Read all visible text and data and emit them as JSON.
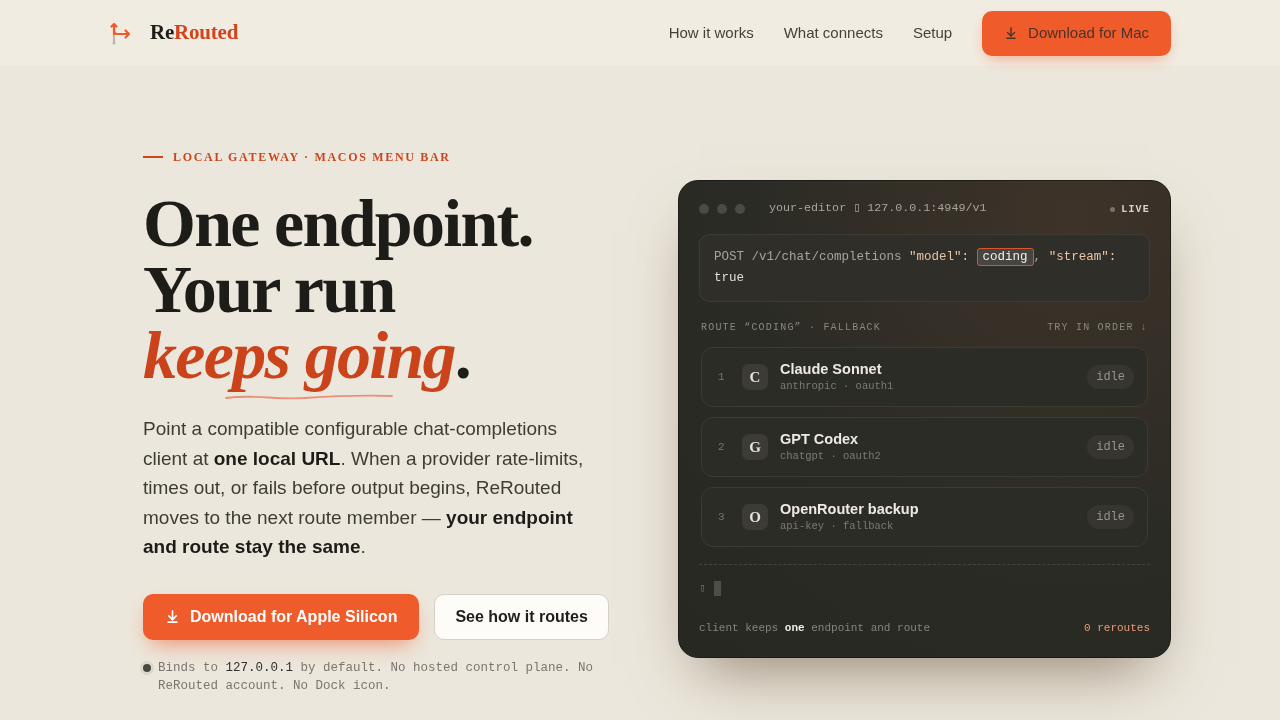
{
  "header": {
    "brand": [
      {
        "text": "Re",
        "kind": "plain"
      },
      {
        "text": "Routed",
        "kind": "accent"
      }
    ],
    "nav": [
      "How it works",
      "What connects",
      "Setup"
    ],
    "cta": "Download for Mac"
  },
  "hero": {
    "eyebrow": "LOCAL GATEWAY · MACOS MENU BAR",
    "headline": "One endpoint.\nYour run\n*keeps going*.",
    "body": "Point a compatible configurable chat-completions client at **one local URL**. When a provider rate-limits, times out, or fails before output begins, ReRouted moves to the next route member — **your endpoint and route stay the same**.",
    "buttons": [
      {
        "label": "Download for Apple Silicon",
        "kind": "primary"
      },
      {
        "label": "See how it routes",
        "kind": "secondary"
      }
    ],
    "note": "Binds to **127.0.0.1** by default. No hosted control plane. No ReRouted account. No Dock icon."
  },
  "terminal": {
    "title": "your-editor ▯ 127.0.0.1:4949/v1",
    "status": "LIVE",
    "request": [
      {
        "text": "POST /v1/chat/completions",
        "kind": "plain"
      },
      {
        "text": "\"model\":",
        "kind": "key"
      },
      {
        "text": "coding",
        "kind": "chip"
      },
      {
        "text": ",",
        "kind": "punct"
      },
      {
        "text": "\"stream\":",
        "kind": "key"
      },
      {
        "text": "true",
        "kind": "value"
      }
    ],
    "route_label": "ROUTE “CODING” · FALLBACK",
    "order_label": "TRY IN ORDER ↓",
    "routes": [
      {
        "index": "1",
        "initial": "C",
        "name": "Claude Sonnet",
        "detail": "anthropic · oauth1",
        "status": "idle"
      },
      {
        "index": "2",
        "initial": "G",
        "name": "GPT Codex",
        "detail": "chatgpt · oauth2",
        "status": "idle"
      },
      {
        "index": "3",
        "initial": "O",
        "name": "OpenRouter backup",
        "detail": "api-key · fallback",
        "status": "idle"
      }
    ],
    "prompt": "▯",
    "footer": "client keeps **one** endpoint and route",
    "reroutes": "0 reroutes"
  }
}
